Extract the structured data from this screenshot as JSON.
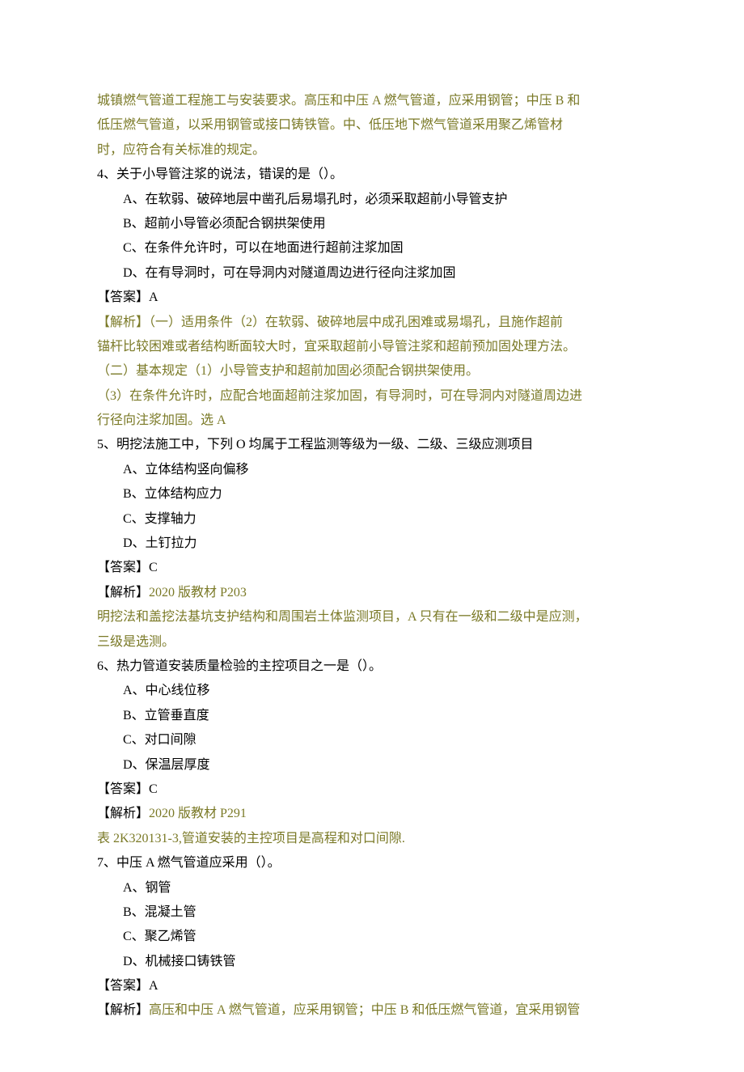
{
  "colors": {
    "olive": "#7a7926",
    "black": "#000000"
  },
  "lines": [
    {
      "cls": "olive",
      "text": "城镇燃气管道工程施工与安装要求。高压和中压 A 燃气管道，应采用钢管；中压 B 和"
    },
    {
      "cls": "olive",
      "text": "低压燃气管道，以采用钢管或接口铸铁管。中、低压地下燃气管道采用聚乙烯管材"
    },
    {
      "cls": "olive",
      "text": "时，应符合有关标准的规定。"
    },
    {
      "cls": "black",
      "text": "4、关于小导管注浆的说法，错误的是（）。"
    },
    {
      "cls": "black indent1",
      "text": "A、在软弱、破碎地层中凿孔后易塌孔时，必须采取超前小导管支护"
    },
    {
      "cls": "black indent1",
      "text": "B、超前小导管必须配合钢拱架使用"
    },
    {
      "cls": "black indent1",
      "text": "C、在条件允许时，可以在地面进行超前注浆加固"
    },
    {
      "cls": "black indent1",
      "text": "D、在有导洞时，可在导洞内对隧道周边进行径向注浆加固"
    },
    {
      "cls": "black",
      "text": "【答案】A"
    },
    {
      "cls": "olive",
      "text": "【解析】（一）适用条件（2）在软弱、破碎地层中成孔困难或易塌孔，且施作超前"
    },
    {
      "cls": "olive",
      "text": "锚杆比较困难或者结构断面较大时，宜采取超前小导管注浆和超前预加固处理方法。"
    },
    {
      "cls": "olive",
      "text": "（二）基本规定（1）小导管支护和超前加固必须配合钢拱架使用。"
    },
    {
      "cls": "olive",
      "text": "（3）在条件允许时，应配合地面超前注浆加固，有导洞时，可在导洞内对隧道周边进"
    },
    {
      "cls": "olive",
      "text": "行径向注浆加固。选 A"
    },
    {
      "cls": "black",
      "text": "5、明挖法施工中，下列 O 均属于工程监测等级为一级、二级、三级应测项目"
    },
    {
      "cls": "black indent1",
      "text": "A、立体结构竖向偏移"
    },
    {
      "cls": "black indent1",
      "text": "B、立体结构应力"
    },
    {
      "cls": "black indent1",
      "text": "C、支撑轴力"
    },
    {
      "cls": "black indent1",
      "text": "D、土钉拉力"
    },
    {
      "cls": "black",
      "text": "【答案】C"
    },
    {
      "cls": "mixed",
      "fragments": [
        {
          "cls": "black",
          "text": "【解析】"
        },
        {
          "cls": "olive",
          "text": "2020 版教材 P203"
        }
      ]
    },
    {
      "cls": "olive",
      "text": "明挖法和盖挖法基坑支护结构和周围岩土体监测项目，A 只有在一级和二级中是应测，"
    },
    {
      "cls": "olive",
      "text": "三级是选测。"
    },
    {
      "cls": "black",
      "text": "6、热力管道安装质量检验的主控项目之一是（）。"
    },
    {
      "cls": "black indent1",
      "text": "A、中心线位移"
    },
    {
      "cls": "black indent1",
      "text": "B、立管垂直度"
    },
    {
      "cls": "black indent1",
      "text": "C、对口间隙"
    },
    {
      "cls": "black indent1",
      "text": "D、保温层厚度"
    },
    {
      "cls": "black",
      "text": "【答案】C"
    },
    {
      "cls": "mixed",
      "fragments": [
        {
          "cls": "black",
          "text": "【解析】"
        },
        {
          "cls": "olive",
          "text": "2020 版教材 P291"
        }
      ]
    },
    {
      "cls": "olive",
      "text": "表 2K320131-3,管道安装的主控项目是高程和对口间隙."
    },
    {
      "cls": "black",
      "text": "7、中压 A 燃气管道应采用（）。"
    },
    {
      "cls": "black indent1",
      "text": "A、钢管"
    },
    {
      "cls": "black indent1",
      "text": "B、混凝土管"
    },
    {
      "cls": "black indent1",
      "text": "C、聚乙烯管"
    },
    {
      "cls": "black indent1",
      "text": "D、机械接口铸铁管"
    },
    {
      "cls": "black",
      "text": "【答案】A"
    },
    {
      "cls": "mixed",
      "fragments": [
        {
          "cls": "black",
          "text": "【解析】"
        },
        {
          "cls": "olive",
          "text": "高压和中压 A 燃气管道，应采用钢管；中压 B 和低压燃气管道，宜采用钢管"
        }
      ]
    }
  ]
}
